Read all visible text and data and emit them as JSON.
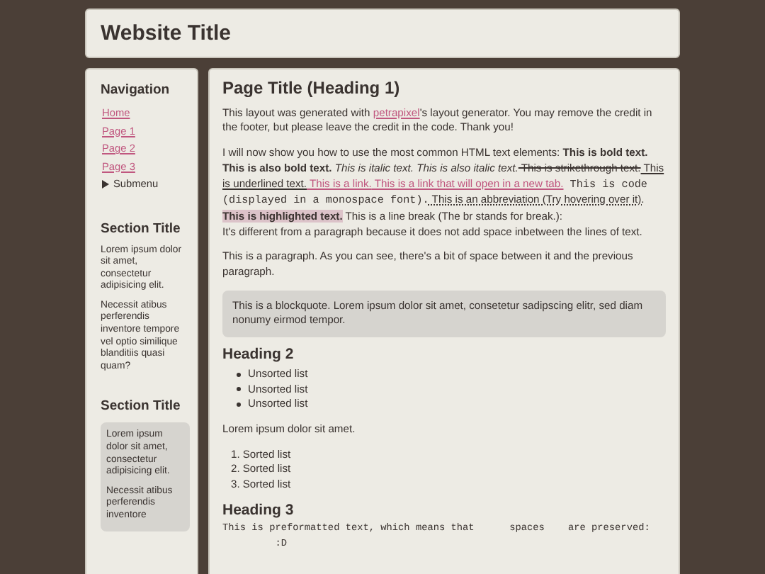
{
  "header": {
    "title": "Website Title"
  },
  "sidebar": {
    "navigation": {
      "title": "Navigation",
      "items": [
        {
          "label": "Home",
          "kind": "link"
        },
        {
          "label": "Page 1",
          "kind": "link"
        },
        {
          "label": "Page 2",
          "kind": "link"
        },
        {
          "label": "Page 3",
          "kind": "link"
        },
        {
          "label": "Submenu",
          "kind": "submenu"
        }
      ]
    },
    "sections": [
      {
        "title": "Section Title",
        "boxed": false,
        "paragraphs": [
          "Lorem ipsum dolor sit amet, consectetur adipisicing elit.",
          "Necessit atibus perferendis inventore tempore vel optio similique blanditiis quasi quam?"
        ]
      },
      {
        "title": "Section Title",
        "boxed": true,
        "paragraphs": [
          "Lorem ipsum dolor sit amet, consectetur adipisicing elit.",
          "Necessit atibus perferendis inventore"
        ]
      }
    ]
  },
  "main": {
    "heading1": "Page Title (Heading 1)",
    "intro": [
      {
        "kind": "text",
        "text": "This layout was generated with "
      },
      {
        "kind": "link",
        "text": "petrapixel"
      },
      {
        "kind": "text",
        "text": "'s layout generator. You may remove the credit in the footer, but please leave the credit in the code. Thank you!"
      }
    ],
    "elements": [
      {
        "kind": "text",
        "text": "I will now show you how to use the most common HTML text elements: "
      },
      {
        "kind": "bold",
        "text": "This is bold text. This is also bold text."
      },
      {
        "kind": "italic",
        "text": " This is italic text. This is also italic text."
      },
      {
        "kind": "strike",
        "text": " This is strikethrough text."
      },
      {
        "kind": "underline",
        "text": " This is underlined text."
      },
      {
        "kind": "link",
        "text": " This is a link."
      },
      {
        "kind": "link",
        "text": " This is a link that will open in a new tab."
      },
      {
        "kind": "code",
        "text": " This is code (displayed in a monospace font)."
      },
      {
        "kind": "abbr",
        "text": " This is an abbreviation (Try hovering over it)."
      },
      {
        "kind": "highlight",
        "text": "This is highlighted text."
      },
      {
        "kind": "text",
        "text": " This is a line break (The br stands for break.):"
      },
      {
        "kind": "break",
        "text": "It's different from a paragraph because it does not add space inbetween the lines of text."
      }
    ],
    "paragraph": "This is a paragraph. As you can see, there's a bit of space between it and the previous paragraph.",
    "blockquote": "This is a blockquote. Lorem ipsum dolor sit amet, consetetur sadipscing elitr, sed diam nonumy eirmod tempor.",
    "heading2": "Heading 2",
    "unordered_list": [
      "Unsorted list",
      "Unsorted list",
      "Unsorted list"
    ],
    "lorem": "Lorem ipsum dolor sit amet.",
    "ordered_list": [
      {
        "number": "1.",
        "text": "Sorted list"
      },
      {
        "number": "2.",
        "text": "Sorted list"
      },
      {
        "number": "3.",
        "text": "Sorted list"
      }
    ],
    "heading3": "Heading 3",
    "preformatted": "This is preformatted text, which means that      spaces    are preserved:\n         :D"
  }
}
